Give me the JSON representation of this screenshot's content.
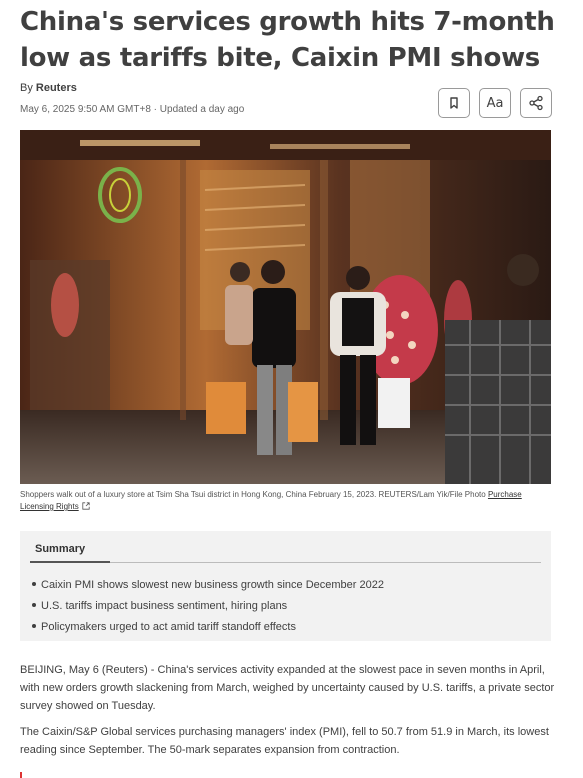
{
  "article": {
    "headline": "China's services growth hits 7-month low as tariffs bite, Caixin PMI shows",
    "byline_prefix": "By",
    "author": "Reuters",
    "dateline": "May 6, 2025 9:50 AM GMT+8 · Updated a day ago"
  },
  "toolbar": {
    "bookmark_icon": "bookmark-icon",
    "text_size_label": "Aa",
    "share_icon": "share-icon"
  },
  "photo": {
    "caption": "Shoppers walk out of a luxury store at Tsim Sha Tsui district in Hong Kong, China February 15, 2023. REUTERS/Lam Yik/File Photo",
    "licensing_link": "Purchase Licensing Rights"
  },
  "summary": {
    "title": "Summary",
    "items": [
      "Caixin PMI shows slowest new business growth since December 2022",
      "U.S. tariffs impact business sentiment, hiring plans",
      "Policymakers urged to act amid tariff standoff effects"
    ]
  },
  "body": {
    "paragraphs": [
      "BEIJING, May 6 (Reuters) - China's services activity expanded at the slowest pace in seven months in April, with new orders growth slackening from March, weighed by uncertainty caused by U.S. tariffs, a private sector survey showed on Tuesday.",
      "The Caixin/S&P Global services purchasing managers' index (PMI), fell to 50.7 from 51.9 in March, its lowest reading since September. The 50-mark separates expansion from contraction."
    ]
  }
}
